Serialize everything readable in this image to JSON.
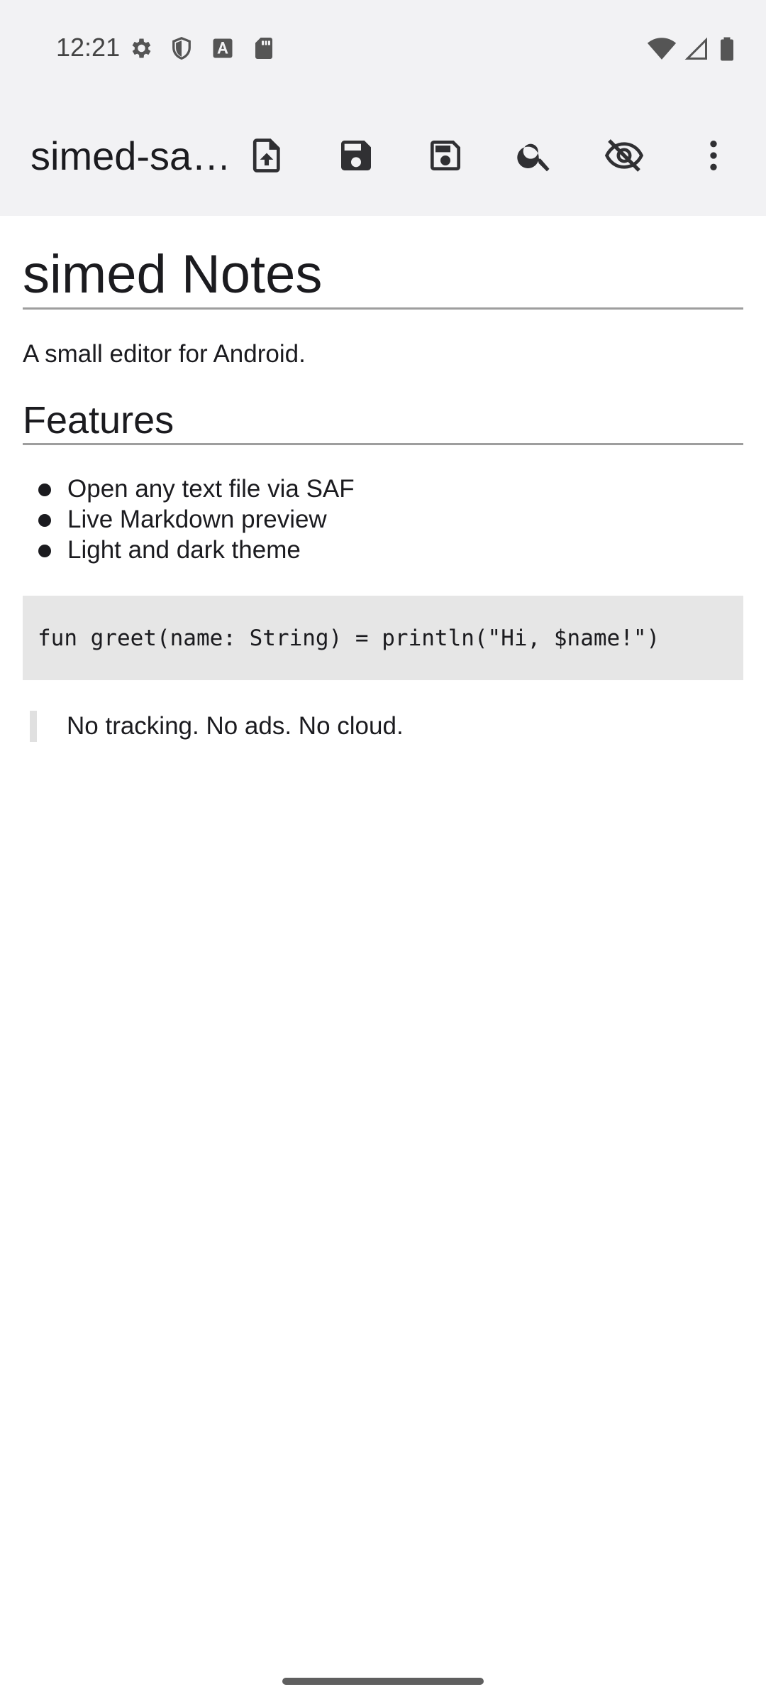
{
  "status_bar": {
    "time": "12:21",
    "left_icons": [
      "settings-icon",
      "shield-icon",
      "text-a-icon",
      "sd-card-icon"
    ],
    "right_icons": [
      "wifi-icon",
      "cell-signal-icon",
      "battery-icon"
    ]
  },
  "toolbar": {
    "title": "simed-sa…",
    "actions": [
      "open-file-icon",
      "save-icon",
      "save-as-icon",
      "search-icon",
      "preview-toggle-icon",
      "overflow-menu-icon"
    ]
  },
  "document": {
    "h1": "simed Notes",
    "intro": "A small editor for Android.",
    "h2": "Features",
    "features": [
      "Open any text file via SAF",
      "Live Markdown preview",
      "Light and dark theme"
    ],
    "code": "fun greet(name: String) = println(\"Hi, $name!\")",
    "quote": "No tracking. No ads. No cloud."
  },
  "colors": {
    "chrome_bg": "#f2f2f4",
    "code_bg": "#e6e6e6",
    "text": "#1b1b1f"
  }
}
